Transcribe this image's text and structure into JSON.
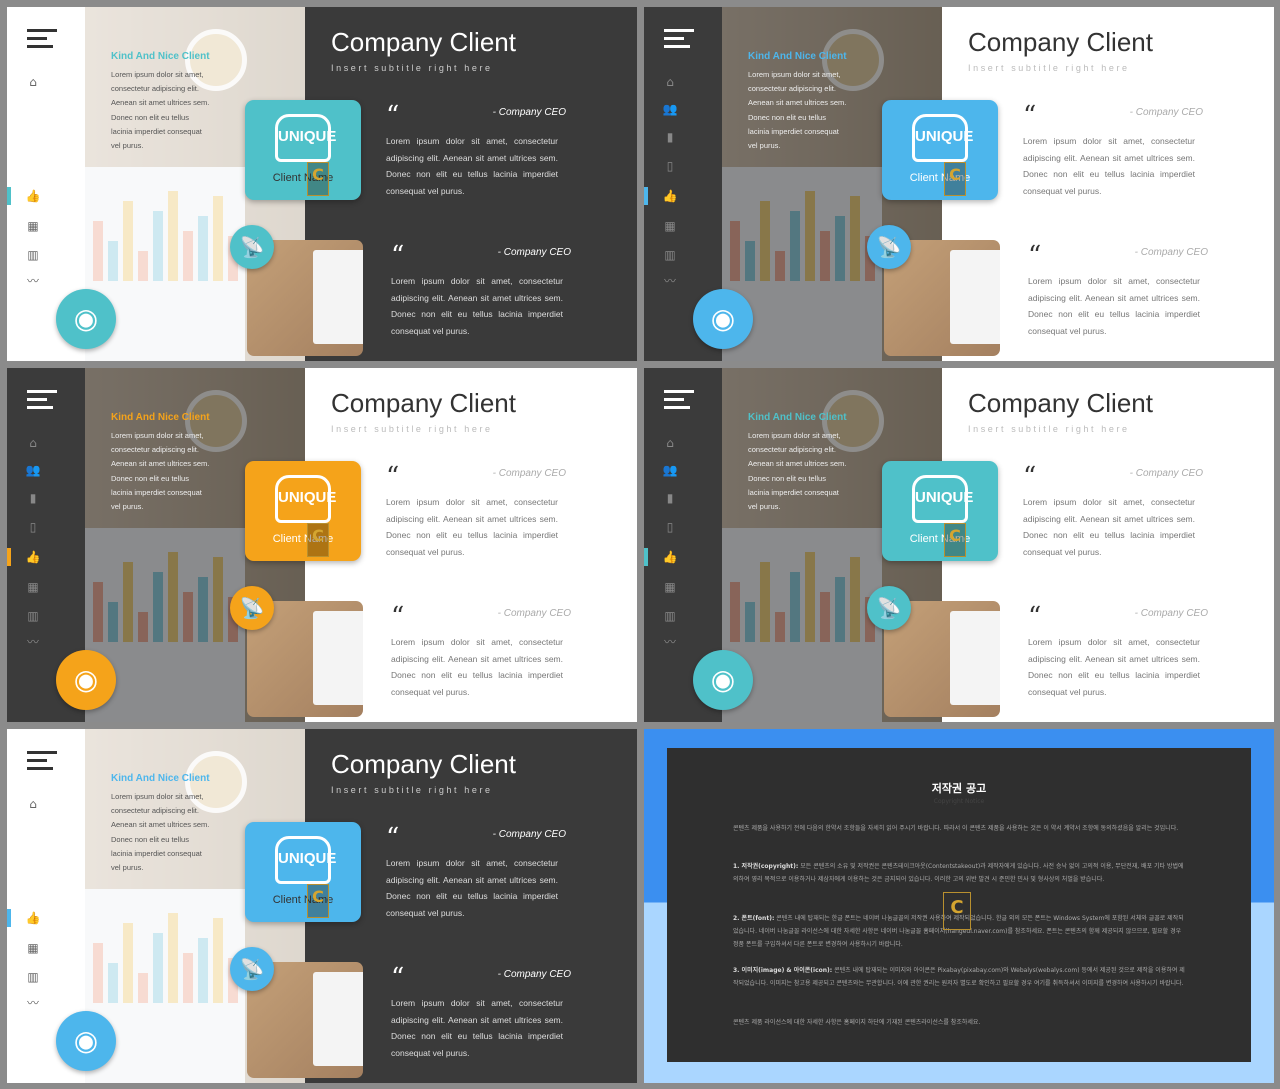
{
  "slides": [
    {
      "theme": "light",
      "accent": "#4fc1c9",
      "nav": [
        "home",
        "thumbs-up",
        "grid",
        "bar-chart",
        "line-chart"
      ],
      "active": "thumbs-up",
      "title": "Company Client",
      "subtitle": "Insert subtitle right here",
      "kind_title": "Kind And Nice Client",
      "kind_body": "Lorem ipsum dolor sit amet, consectetur adipiscing elit. Aenean sit amet ultrices sem. Donec non elit eu tellus lacinia imperdiet consequat vel purus.",
      "logo": "UNIQUE",
      "client_name": "Client Name",
      "quotes": [
        {
          "author": "- Company CEO",
          "text": "Lorem ipsum dolor sit amet, consectetur adipiscing elit. Aenean sit amet ultrices sem. Donec non elit eu tellus lacinia imperdiet consequat vel purus."
        },
        {
          "author": "- Company CEO",
          "text": "Lorem ipsum dolor sit amet, consectetur adipiscing elit. Aenean sit amet ultrices sem. Donec non elit eu tellus lacinia imperdiet consequat vel purus."
        }
      ]
    },
    {
      "theme": "dark",
      "accent": "#4db6ec",
      "nav": [
        "home",
        "users",
        "book",
        "phone",
        "thumbs-up",
        "grid",
        "bar-chart",
        "line-chart"
      ],
      "active": "thumbs-up",
      "title": "Company Client",
      "subtitle": "Insert subtitle right here",
      "kind_title": "Kind And Nice Client",
      "kind_body": "Lorem ipsum dolor sit amet, consectetur adipiscing elit. Aenean sit amet ultrices sem. Donec non elit eu tellus lacinia imperdiet consequat vel purus.",
      "logo": "UNIQUE",
      "client_name": "Client Name",
      "quotes": [
        {
          "author": "- Company CEO",
          "text": "Lorem ipsum dolor sit amet, consectetur adipiscing elit. Aenean sit amet ultrices sem. Donec non elit eu tellus lacinia imperdiet consequat vel purus."
        },
        {
          "author": "- Company CEO",
          "text": "Lorem ipsum dolor sit amet, consectetur adipiscing elit. Aenean sit amet ultrices sem. Donec non elit eu tellus lacinia imperdiet consequat vel purus."
        }
      ]
    },
    {
      "theme": "dark",
      "accent": "#f5a31a",
      "nav": [
        "home",
        "users",
        "book",
        "phone",
        "thumbs-up",
        "grid",
        "bar-chart",
        "line-chart"
      ],
      "active": "thumbs-up",
      "title": "Company Client",
      "subtitle": "Insert subtitle right here",
      "kind_title": "Kind And Nice Client",
      "kind_body": "Lorem ipsum dolor sit amet, consectetur adipiscing elit. Aenean sit amet ultrices sem. Donec non elit eu tellus lacinia imperdiet consequat vel purus.",
      "logo": "UNIQUE",
      "client_name": "Client Name",
      "quotes": [
        {
          "author": "- Company CEO",
          "text": "Lorem ipsum dolor sit amet, consectetur adipiscing elit. Aenean sit amet ultrices sem. Donec non elit eu tellus lacinia imperdiet consequat vel purus."
        },
        {
          "author": "- Company CEO",
          "text": "Lorem ipsum dolor sit amet, consectetur adipiscing elit. Aenean sit amet ultrices sem. Donec non elit eu tellus lacinia imperdiet consequat vel purus."
        }
      ]
    },
    {
      "theme": "dark",
      "accent": "#4fc1c9",
      "nav": [
        "home",
        "users",
        "book",
        "phone",
        "thumbs-up",
        "grid",
        "bar-chart",
        "line-chart"
      ],
      "active": "thumbs-up",
      "title": "Company Client",
      "subtitle": "Insert subtitle right here",
      "kind_title": "Kind And Nice Client",
      "kind_body": "Lorem ipsum dolor sit amet, consectetur adipiscing elit. Aenean sit amet ultrices sem. Donec non elit eu tellus lacinia imperdiet consequat vel purus.",
      "logo": "UNIQUE",
      "client_name": "Client Name",
      "quotes": [
        {
          "author": "- Company CEO",
          "text": "Lorem ipsum dolor sit amet, consectetur adipiscing elit. Aenean sit amet ultrices sem. Donec non elit eu tellus lacinia imperdiet consequat vel purus."
        },
        {
          "author": "- Company CEO",
          "text": "Lorem ipsum dolor sit amet, consectetur adipiscing elit. Aenean sit amet ultrices sem. Donec non elit eu tellus lacinia imperdiet consequat vel purus."
        }
      ]
    },
    {
      "theme": "light",
      "accent": "#4db6ec",
      "nav": [
        "home",
        "thumbs-up",
        "grid",
        "bar-chart",
        "line-chart"
      ],
      "active": "thumbs-up",
      "title": "Company Client",
      "subtitle": "Insert subtitle right here",
      "kind_title": "Kind And Nice Client",
      "kind_body": "Lorem ipsum dolor sit amet, consectetur adipiscing elit. Aenean sit amet ultrices sem. Donec non elit eu tellus lacinia imperdiet consequat vel purus.",
      "logo": "UNIQUE",
      "client_name": "Client Name",
      "quotes": [
        {
          "author": "- Company CEO",
          "text": "Lorem ipsum dolor sit amet, consectetur adipiscing elit. Aenean sit amet ultrices sem. Donec non elit eu tellus lacinia imperdiet consequat vel purus."
        },
        {
          "author": "- Company CEO",
          "text": "Lorem ipsum dolor sit amet, consectetur adipiscing elit. Aenean sit amet ultrices sem. Donec non elit eu tellus lacinia imperdiet consequat vel purus."
        }
      ]
    }
  ],
  "notice": {
    "title": "저작권 공고",
    "subtitle": "Copyright Notice",
    "intro": "콘텐츠 제품을 사용하기 전에 다음의 한약서 조항들을 자세히 읽어 주시기 바랍니다. 따라서 이 콘텐츠 제품을 사용하는 것은 이 약서 계약서 조항에 동의하셨음을 알리는 것입니다.",
    "items": [
      {
        "head": "1. 저작권(copyright):",
        "body": "모든 콘텐츠의 소유 및 저작권은 콘텐츠테이크아웃(Contentstakeout)과 제작자에게 있습니다. 사전 승낙 없이 고의적 이용, 무단전재, 배포 기타 방법에 의하여 영리 목적으로 이용하거나 제삼자에게 이용하는 것은 금지되어 있습니다. 이러한 고의 위반 발견 시 준민한 민사 및 형사상의 처벌을 받습니다."
      },
      {
        "head": "2. 폰트(font):",
        "body": "콘텐츠 내에 탑재되는 한글 폰트는 네이버 나눔글꼴의 저작권 사용하여 제작되었습니다. 한글 외의 모든 폰트는 Windows System에 포함된 서체와 글꼴로 제작되었습니다. 네이버 나눔글꼴 라이선스에 대한 자세한 사항은 네이버 나눔글꼴 홈페이지(hangeul.naver.com)를 참조하세요. 폰트는 콘텐츠의 함께 제공되지 않으므로, 필요할 경우 정품 폰트를 구입하셔서 다른 폰트로 변경하여 사용하시기 바랍니다."
      },
      {
        "head": "3. 이미지(image) & 아이콘(icon):",
        "body": "콘텐츠 내에 탑재되는 이미지와 아이콘은 Pixabay(pixabay.com)와 Webalys(webalys.com) 등에서 제공된 것으로 제작을 이용하여 제작되었습니다. 이미지는 참고용 제공되고 콘텐츠와는 무관합니다. 이에 관한 권리는 원저자 별도로 확인하고 필요할 경우 여기를 취득하셔서 이미지를 변경하여 사용하시기 바랍니다."
      }
    ],
    "footer": "콘텐츠 제품 라이선스에 대한 자세한 사항은 홈페이지 하단에 기재된 콘텐츠라이선스를 참조하세요."
  }
}
